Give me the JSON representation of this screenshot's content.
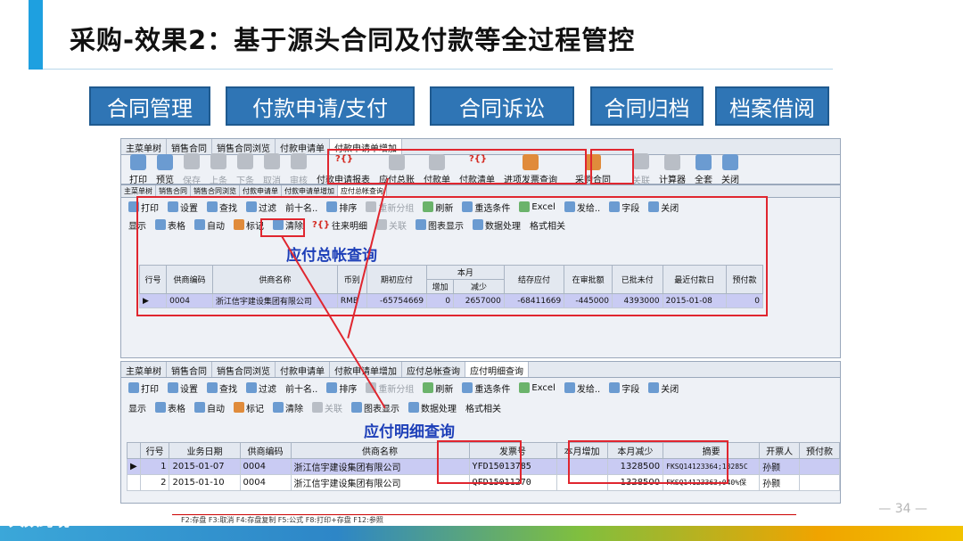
{
  "slide": {
    "title": "采购-效果2：基于源头合同及付款等全过程管控",
    "page_number": "— 34 —",
    "watermark": "大数跨境"
  },
  "categories": [
    "合同管理",
    "付款申请/支付",
    "合同诉讼",
    "合同归档",
    "档案借阅"
  ],
  "win1": {
    "tabs": [
      "主菜单树",
      "销售合同",
      "销售合同浏览",
      "付款申请单",
      "付款申请单增加"
    ],
    "active_tab": 4,
    "toolbar": {
      "print": "打印",
      "preview": "预览",
      "save": "保存",
      "up": "上条",
      "down": "下条",
      "cancel": "取消",
      "audit": "审核",
      "pay_apply_report": "付款申请报表",
      "pay_ledger": "应付总账",
      "pay_bill": "付款单",
      "pay_list": "付款清单",
      "input_invoice": "进项发票查询",
      "purchase_contract": "采购合同",
      "related": "关联",
      "calculator": "计算器",
      "select_all": "全套",
      "close": "关闭"
    }
  },
  "win2": {
    "tabs": [
      "主菜单树",
      "销售合同",
      "销售合同浏览",
      "付款申请单",
      "付款申请单增加",
      "应付总帐查询"
    ],
    "active_tab": 5,
    "toolbar1": {
      "print": "打印",
      "settings": "设置",
      "find": "查找",
      "filter": "过滤",
      "first_n": "前十名..",
      "sort": "排序",
      "regroup": "重新分组",
      "refresh": "刷新",
      "reselect": "重选条件",
      "excel": "Excel",
      "send": "发给..",
      "field": "字段",
      "close": "关闭"
    },
    "toolbar2": {
      "display": "显示",
      "table": "表格",
      "auto": "自动",
      "mark": "标记",
      "clear": "清除",
      "detail": "往来明细",
      "related": "关联",
      "chart": "图表显示",
      "data_proc": "数据处理",
      "format": "格式相关"
    },
    "query_title": "应付总帐查询",
    "headers": {
      "row_no": "行号",
      "vendor_code": "供商编码",
      "vendor_name": "供商名称",
      "currency": "币别",
      "opening": "期初应付",
      "this_month": "本月",
      "increase": "增加",
      "decrease": "减少",
      "ending": "结存应付",
      "in_approval": "在审批额",
      "approved_unpaid": "已批未付",
      "last_pay_date": "最近付款日",
      "prepaid": "预付款"
    },
    "rows": [
      {
        "vendor_code": "0004",
        "vendor_name": "浙江信宇建设集团有限公司",
        "currency": "RMB",
        "opening": "-65754669",
        "increase": "0",
        "decrease": "2657000",
        "ending": "-68411669",
        "in_approval": "-445000",
        "approved_unpaid": "4393000",
        "last_pay_date": "2015-01-08",
        "prepaid": "0"
      }
    ]
  },
  "win3": {
    "tabs": [
      "主菜单树",
      "销售合同",
      "销售合同浏览",
      "付款申请单",
      "付款申请单增加",
      "应付总帐查询",
      "应付明细查询"
    ],
    "active_tab": 6,
    "toolbar1": {
      "print": "打印",
      "settings": "设置",
      "find": "查找",
      "filter": "过滤",
      "first_n": "前十名..",
      "sort": "排序",
      "regroup": "重新分组",
      "refresh": "刷新",
      "reselect": "重选条件",
      "excel": "Excel",
      "send": "发给..",
      "field": "字段",
      "close": "关闭"
    },
    "toolbar2": {
      "display": "显示",
      "table": "表格",
      "auto": "自动",
      "mark": "标记",
      "clear": "清除",
      "related": "关联",
      "chart": "图表显示",
      "data_proc": "数据处理",
      "format": "格式相关"
    },
    "query_title": "应付明细查询",
    "headers": {
      "row_no": "行号",
      "biz_date": "业务日期",
      "vendor_code": "供商编码",
      "vendor_name": "供商名称",
      "invoice_no": "发票号",
      "month_inc": "本月增加",
      "month_dec": "本月减少",
      "summary": "摘要",
      "issuer": "开票人",
      "prepaid": "预付款"
    },
    "rows": [
      {
        "row_no": "1",
        "biz_date": "2015-01-07",
        "vendor_code": "0004",
        "vendor_name": "浙江信宇建设集团有限公司",
        "invoice_no": "YFD15013785",
        "month_inc": "",
        "month_dec": "1328500",
        "summary": "FKSQ14123364;13285C",
        "issuer": "孙颢",
        "prepaid": ""
      },
      {
        "row_no": "2",
        "biz_date": "2015-01-10",
        "vendor_code": "0004",
        "vendor_name": "浙江信宇建设集团有限公司",
        "invoice_no": "QFD15011270",
        "month_inc": "",
        "month_dec": "1328500",
        "summary": "FKSQ14123363;040%保",
        "issuer": "孙颢",
        "prepaid": ""
      }
    ]
  },
  "status_hotkeys": "F2:存盘 F3:取消 F4:存盘复制 F5:公式 F8:打印+存盘 F12:参照"
}
